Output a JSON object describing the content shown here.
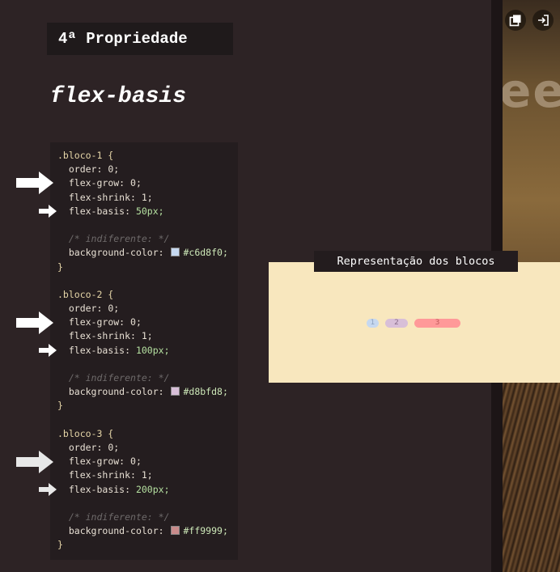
{
  "header": {
    "title": "4ª Propriedade"
  },
  "property": {
    "name": "flex-basis"
  },
  "code": {
    "blocks": [
      {
        "selector": ".bloco-1 {",
        "order": "order: 0;",
        "grow": "flex-grow: 0;",
        "shrink": "flex-shrink: 1;",
        "basis_prop": "flex-basis: ",
        "basis_val": "50px;",
        "comment": "/* indiferente: */",
        "bg_prop": "background-color: ",
        "bg_val": "#c6d8f0;",
        "close": "}",
        "color": "#c6d8f0"
      },
      {
        "selector": ".bloco-2 {",
        "order": "order: 0;",
        "grow": "flex-grow: 0;",
        "shrink": "flex-shrink: 1;",
        "basis_prop": "flex-basis: ",
        "basis_val": "100px;",
        "comment": "/* indiferente: */",
        "bg_prop": "background-color: ",
        "bg_val": "#d8bfd8;",
        "close": "}",
        "color": "#d8bfd8"
      },
      {
        "selector": ".bloco-3 {",
        "order": "order: 0;",
        "grow": "flex-grow: 0;",
        "shrink": "flex-shrink: 1;",
        "basis_prop": "flex-basis: ",
        "basis_val": "200px;",
        "comment": "/* indiferente: */",
        "bg_prop": "background-color: ",
        "bg_val": "#ff9999;",
        "close": "}",
        "color": "#ff9999"
      }
    ]
  },
  "representation": {
    "title": "Representação dos blocos",
    "blocks": [
      {
        "label": "1",
        "color": "#c6d8f0"
      },
      {
        "label": "2",
        "color": "#d8bfd8"
      },
      {
        "label": "3",
        "color": "#ff9999"
      }
    ]
  },
  "video": {
    "text": "ee"
  },
  "icons": {
    "popout": "popout-icon",
    "exit": "exit-icon"
  }
}
